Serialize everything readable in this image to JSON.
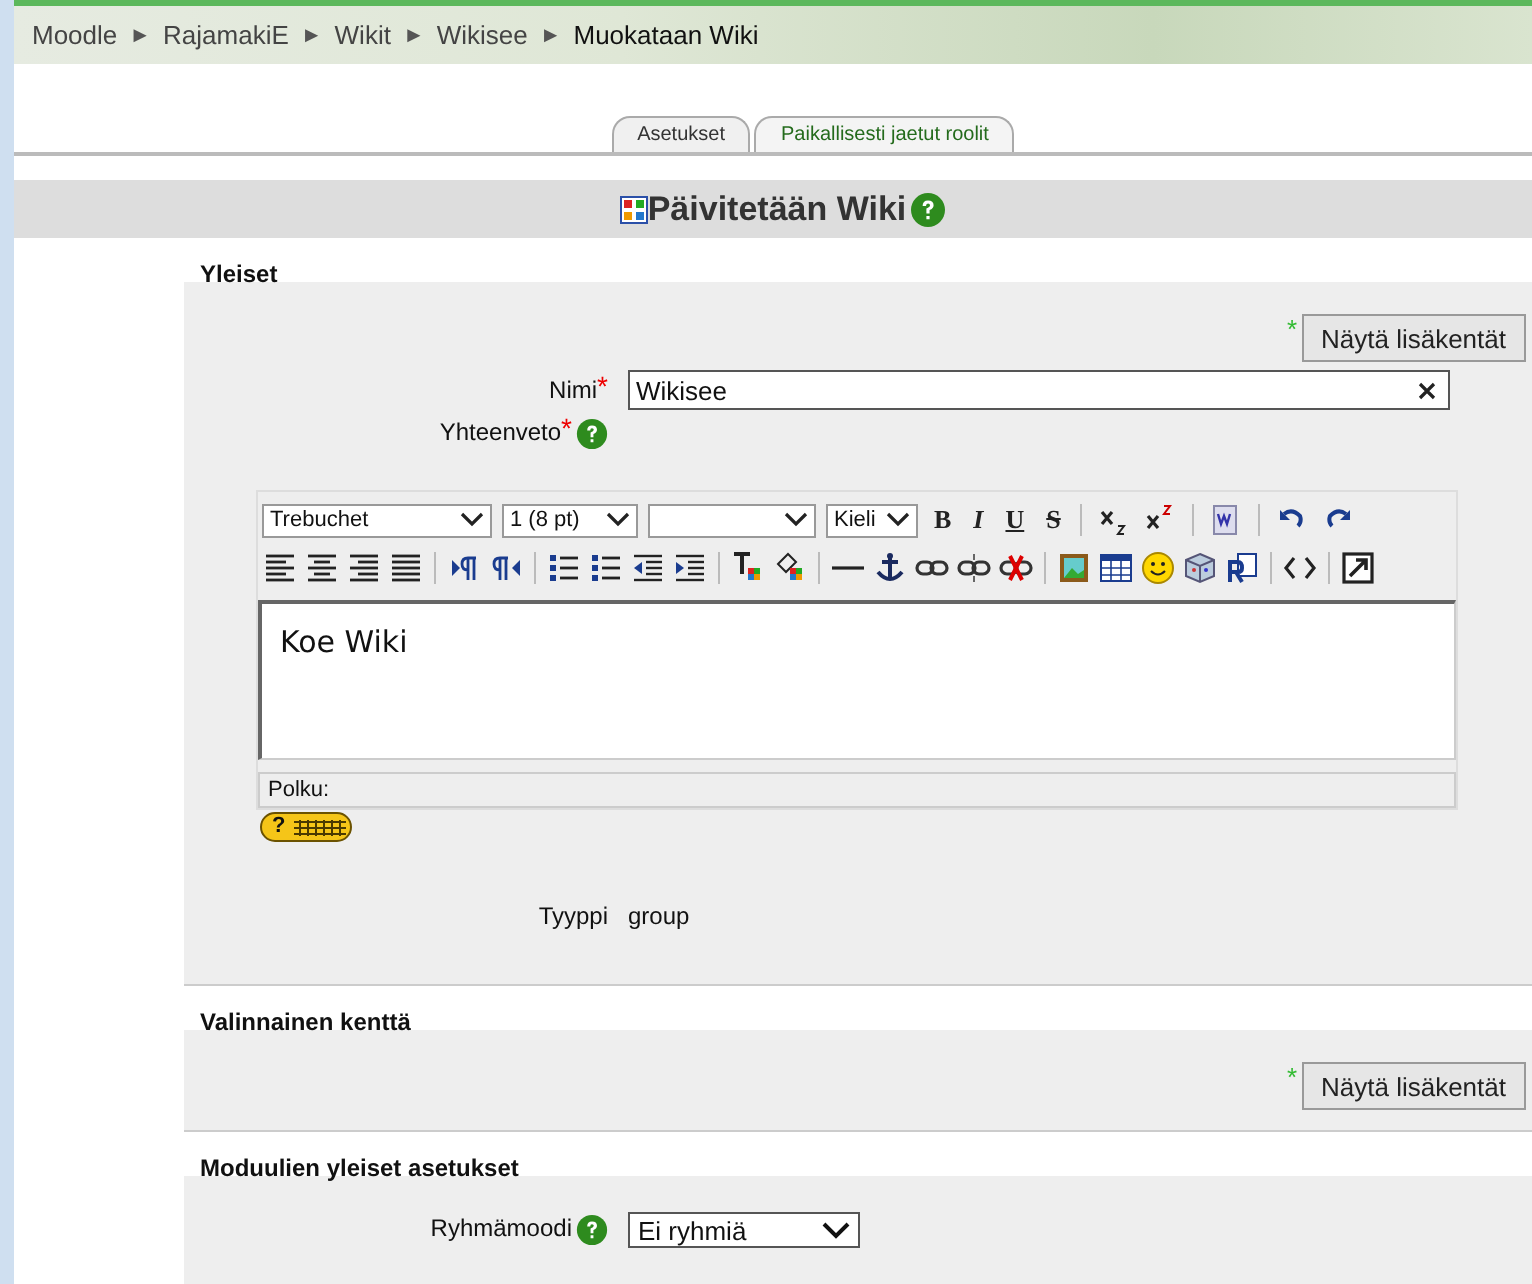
{
  "breadcrumb": [
    {
      "label": "Moodle",
      "current": false
    },
    {
      "label": "RajamakiE",
      "current": false
    },
    {
      "label": "Wikit",
      "current": false
    },
    {
      "label": "Wikisee",
      "current": false
    },
    {
      "label": "Muokataan Wiki",
      "current": true
    }
  ],
  "breadcrumb_separator": "►",
  "tabs": [
    {
      "label": "Asetukset",
      "selected": true
    },
    {
      "label": "Paikallisesti jaetut roolit",
      "selected": false
    }
  ],
  "heading": "Päivitetään Wiki",
  "sections": [
    {
      "legend": "Yleiset",
      "advanced_mark": "*",
      "required_mark": "*",
      "show_more": "Näytä lisäkentät",
      "name_label": "Nimi",
      "name_value": "Wikisee",
      "summary_label": "Yhteenveto",
      "editor": {
        "selects": [
          {
            "kind": "font",
            "value": "Trebuchet"
          },
          {
            "kind": "size",
            "value": "1 (8 pt)"
          },
          {
            "kind": "format"
          },
          {
            "kind": "language",
            "value": "Kieli"
          }
        ],
        "format_buttons": [
          "B",
          "I",
          "U",
          "S"
        ],
        "content": "Koe Wiki",
        "path_label": "Polku:",
        "keyboard_help_mark": "?"
      },
      "type_label": "Tyyppi",
      "type_value": "group"
    },
    {
      "legend": "Valinnainen kenttä",
      "advanced_mark": "*",
      "show_more": "Näytä lisäkentät"
    },
    {
      "legend": "Moduulien yleiset asetukset",
      "group_mode_label": "Ryhmämoodi",
      "group_mode_value": "Ei ryhmiä"
    }
  ]
}
